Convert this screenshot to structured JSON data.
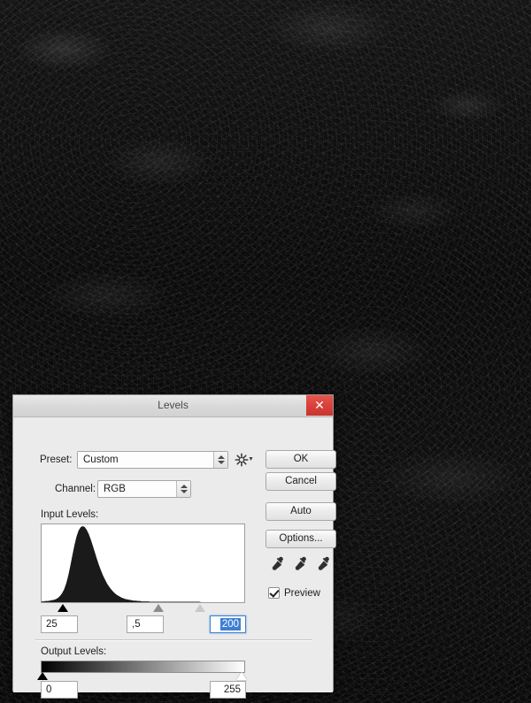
{
  "dialog": {
    "title": "Levels",
    "close_label": "✕",
    "preset": {
      "label": "Preset:",
      "value": "Custom",
      "gear_icon": "gear-icon"
    },
    "channel": {
      "label": "Channel:",
      "value": "RGB"
    },
    "input_levels": {
      "label": "Input Levels:",
      "shadow": "25",
      "midtone": ",5",
      "highlight": "200"
    },
    "output_levels": {
      "label": "Output Levels:",
      "black": "0",
      "white": "255"
    },
    "buttons": {
      "ok": "OK",
      "cancel": "Cancel",
      "auto": "Auto",
      "options": "Options..."
    },
    "preview": {
      "label": "Preview",
      "checked": true
    },
    "eyedroppers": [
      "black-point-eyedropper",
      "gray-point-eyedropper",
      "white-point-eyedropper"
    ],
    "colors": {
      "close_button": "#d93f38",
      "focus_border": "#3a83d6",
      "selection": "#3e7fd4",
      "dialog_bg": "#ebebeb",
      "histogram_fill": "#1a1a1a"
    }
  },
  "histogram": {
    "description": "dark-weighted single-peak luminance histogram",
    "bins": [
      2,
      2,
      3,
      3,
      4,
      5,
      6,
      8,
      11,
      16,
      23,
      33,
      48,
      68,
      93,
      120,
      146,
      168,
      184,
      193,
      196,
      194,
      187,
      176,
      162,
      146,
      129,
      112,
      96,
      82,
      69,
      58,
      48,
      40,
      33,
      27,
      22,
      18,
      15,
      12,
      10,
      8,
      7,
      6,
      5,
      4,
      4,
      3,
      3,
      2,
      2,
      2,
      2,
      1,
      1,
      1,
      1,
      1,
      1,
      1,
      1,
      1,
      1,
      1,
      1,
      1,
      1,
      1,
      1,
      1,
      1,
      1,
      1,
      1,
      1,
      1,
      1,
      1,
      0,
      0,
      0,
      0,
      0,
      0,
      0,
      0,
      0,
      0,
      0,
      0,
      0,
      0,
      0,
      0,
      0,
      0,
      0,
      0,
      0,
      0
    ],
    "max": 196
  }
}
